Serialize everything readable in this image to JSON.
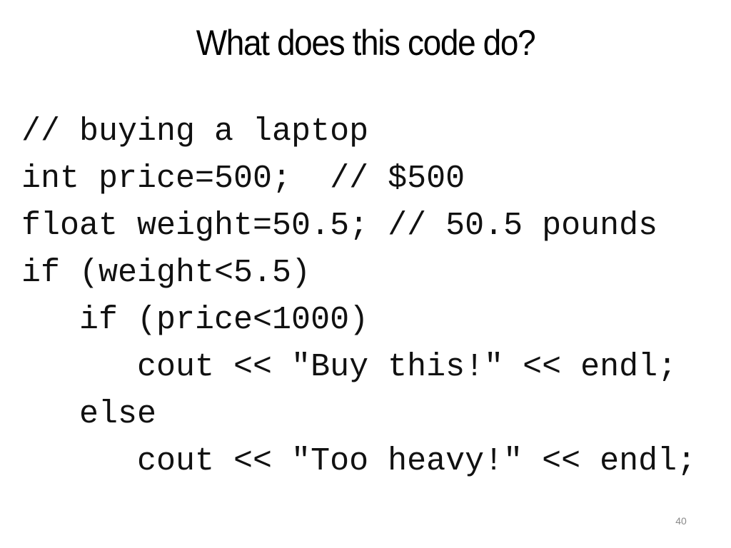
{
  "slide": {
    "title": "What does this code do?",
    "code_lines": [
      "// buying a laptop",
      "int price=500;  // $500",
      "float weight=50.5; // 50.5 pounds",
      "if (weight<5.5)",
      "   if (price<1000)",
      "      cout << \"Buy this!\" << endl;",
      "   else",
      "      cout << \"Too heavy!\" << endl;"
    ],
    "page_number": "40"
  }
}
